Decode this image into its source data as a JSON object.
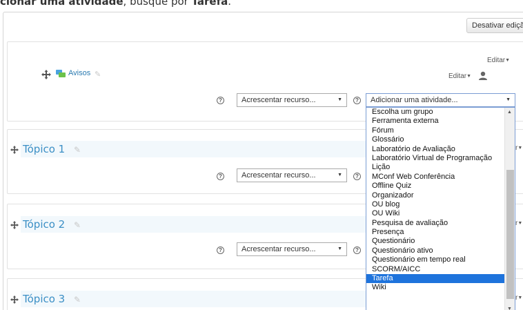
{
  "instruction": {
    "bold_prefix": "cionar uma atividade",
    "middle": ", busque por ",
    "bold_term": "Tarefa",
    "suffix": "."
  },
  "header": {
    "toggle_edit_label": "Desativar edição"
  },
  "section0": {
    "edit_top": "Editar",
    "forum_link": "Avisos",
    "edit_item": "Editar",
    "add_resource": "Acrescentar recurso...",
    "add_activity": "Adicionar uma atividade..."
  },
  "topics": [
    {
      "title": "Tópico 1",
      "edit_cut": "r",
      "add_resource": "Acrescentar recurso..."
    },
    {
      "title": "Tópico 2",
      "edit_cut": "r",
      "add_resource": "Acrescentar recurso..."
    },
    {
      "title": "Tópico 3",
      "edit_cut": "r"
    }
  ],
  "activity_options": [
    "Escolha um grupo",
    "Ferramenta externa",
    "Fórum",
    "Glossário",
    "Laboratório de Avaliação",
    "Laboratório Virtual de Programação",
    "Lição",
    "MConf Web Conferência",
    "Offline Quiz",
    "Organizador",
    "OU blog",
    "OU Wiki",
    "Pesquisa de avaliação",
    "Presença",
    "Questionário",
    "Questionário ativo",
    "Questionário em tempo real",
    "SCORM/AICC",
    "Tarefa",
    "Wiki"
  ],
  "selected_option": "Tarefa",
  "colors": {
    "accent": "#3b8fc5",
    "selected": "#1e73dc",
    "topic_bg": "#f2f8fc"
  },
  "icons": [
    "move-icon",
    "forum-icon",
    "pencil-icon",
    "user-icon",
    "help-icon",
    "chevron-down-icon"
  ]
}
